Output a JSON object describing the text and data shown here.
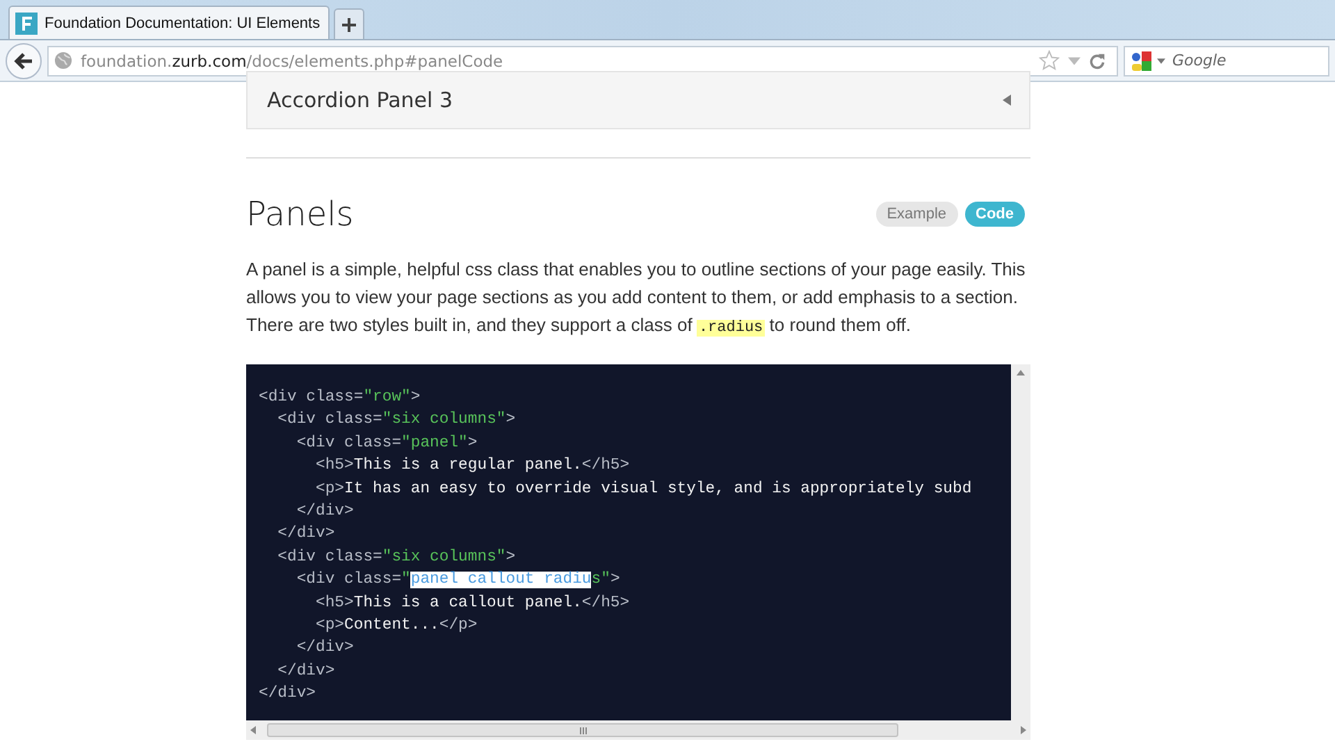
{
  "browser": {
    "tab": {
      "title": "Foundation Documentation: UI Elements"
    },
    "address": {
      "subdomain": "foundation.",
      "domain": "zurb.com",
      "path": "/docs/elements.php#panelCode"
    },
    "search": {
      "placeholder": "Google"
    }
  },
  "accordion": {
    "title": "Accordion Panel 3",
    "expanded": false
  },
  "section": {
    "title": "Panels",
    "toggles": [
      {
        "label": "Example",
        "selected": false
      },
      {
        "label": "Code",
        "selected": true
      }
    ],
    "description": [
      "A panel is a simple, helpful css class that enables you to outline sections of your page easily. This allows you to view your page sections as you add content to them, or add emphasis to a section. There are two styles built in, and they support a class of ",
      ".radius",
      " to round them off."
    ]
  },
  "code": [
    [
      {
        "kind": "tag",
        "text": "<div class=",
        "selected": false
      },
      {
        "kind": "string",
        "text": "\"row\"",
        "selected": false
      },
      {
        "kind": "tag",
        "text": ">",
        "selected": false
      }
    ],
    [
      {
        "kind": "tag",
        "text": "  <div class=",
        "selected": false
      },
      {
        "kind": "string",
        "text": "\"six columns\"",
        "selected": false
      },
      {
        "kind": "tag",
        "text": ">",
        "selected": false
      }
    ],
    [
      {
        "kind": "tag",
        "text": "    <div class=",
        "selected": false
      },
      {
        "kind": "string",
        "text": "\"panel\"",
        "selected": false
      },
      {
        "kind": "tag",
        "text": ">",
        "selected": false
      }
    ],
    [
      {
        "kind": "tag",
        "text": "      <h5>",
        "selected": false
      },
      {
        "kind": "text",
        "text": "This is a regular panel.",
        "selected": false
      },
      {
        "kind": "tag",
        "text": "</h5>",
        "selected": false
      }
    ],
    [
      {
        "kind": "tag",
        "text": "      <p>",
        "selected": false
      },
      {
        "kind": "text",
        "text": "It has an easy to override visual style, and is appropriately subd",
        "selected": false
      }
    ],
    [
      {
        "kind": "tag",
        "text": "    </div>",
        "selected": false
      }
    ],
    [
      {
        "kind": "tag",
        "text": "  </div>",
        "selected": false
      }
    ],
    [
      {
        "kind": "tag",
        "text": "  <div class=",
        "selected": false
      },
      {
        "kind": "string",
        "text": "\"six columns\"",
        "selected": false
      },
      {
        "kind": "tag",
        "text": ">",
        "selected": false
      }
    ],
    [
      {
        "kind": "tag",
        "text": "    <div class=",
        "selected": false
      },
      {
        "kind": "string",
        "text": "\"",
        "selected": false
      },
      {
        "kind": "string",
        "text": "panel callout radiu",
        "selected": true
      },
      {
        "kind": "string",
        "text": "s\"",
        "selected": false
      },
      {
        "kind": "tag",
        "text": ">",
        "selected": false
      }
    ],
    [
      {
        "kind": "tag",
        "text": "      <h5>",
        "selected": false
      },
      {
        "kind": "text",
        "text": "This is a callout panel.",
        "selected": false
      },
      {
        "kind": "tag",
        "text": "</h5>",
        "selected": false
      }
    ],
    [
      {
        "kind": "tag",
        "text": "      <p>",
        "selected": false
      },
      {
        "kind": "text",
        "text": "Content...",
        "selected": false
      },
      {
        "kind": "tag",
        "text": "</p>",
        "selected": false
      }
    ],
    [
      {
        "kind": "tag",
        "text": "    </div>",
        "selected": false
      }
    ],
    [
      {
        "kind": "tag",
        "text": "  </div>",
        "selected": false
      }
    ],
    [
      {
        "kind": "tag",
        "text": "</div>",
        "selected": false
      }
    ]
  ]
}
